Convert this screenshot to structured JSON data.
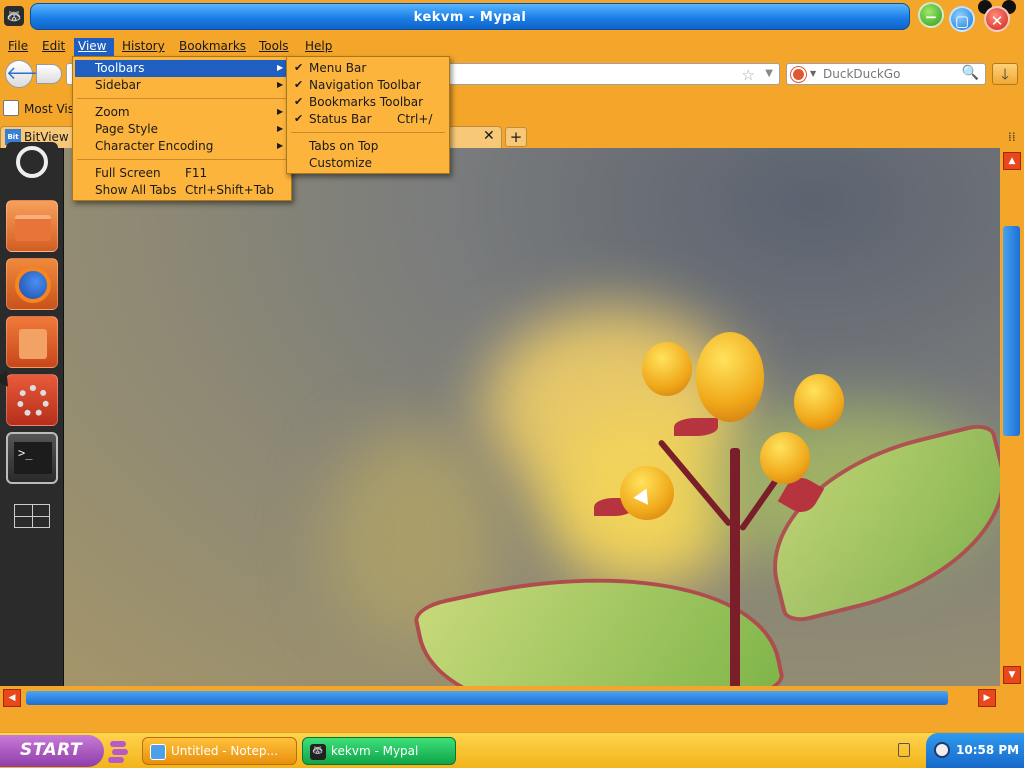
{
  "window": {
    "title": "kekvm - Mypal",
    "app_icon": "mypal-raccoon-icon"
  },
  "menubar": {
    "items": [
      {
        "label": "File",
        "mnemonic_index": 0
      },
      {
        "label": "Edit",
        "mnemonic_index": 0
      },
      {
        "label": "View",
        "mnemonic_index": 0,
        "active": true
      },
      {
        "label": "History",
        "mnemonic_index": 0
      },
      {
        "label": "Bookmarks",
        "mnemonic_index": 0
      },
      {
        "label": "Tools",
        "mnemonic_index": 0
      },
      {
        "label": "Help",
        "mnemonic_index": 0
      }
    ]
  },
  "view_menu": {
    "items": [
      {
        "label": "Toolbars",
        "submenu": true,
        "highlighted": true
      },
      {
        "label": "Sidebar",
        "submenu": true
      },
      {
        "label": "Zoom",
        "submenu": true
      },
      {
        "label": "Page Style",
        "submenu": true
      },
      {
        "label": "Character Encoding",
        "submenu": true
      },
      {
        "label": "Full Screen",
        "shortcut": "F11"
      },
      {
        "label": "Show All Tabs",
        "shortcut": "Ctrl+Shift+Tab"
      }
    ]
  },
  "toolbars_menu": {
    "items": [
      {
        "label": "Menu Bar",
        "checked": true
      },
      {
        "label": "Navigation Toolbar",
        "checked": true
      },
      {
        "label": "Bookmarks Toolbar",
        "checked": true
      },
      {
        "label": "Status Bar",
        "checked": true,
        "shortcut": "Ctrl+/"
      },
      {
        "label": "Tabs on Top",
        "checked": false
      },
      {
        "label": "Customize",
        "checked": false
      }
    ]
  },
  "navbar": {
    "url_value": "",
    "search": {
      "engine_icon": "duckduckgo-icon",
      "placeholder": "DuckDuckGo"
    }
  },
  "bookmarks": {
    "first_item": "Most Visi"
  },
  "tabs": [
    {
      "title": "BitView -",
      "favicon": "bitview-icon"
    }
  ],
  "launcher": {
    "items": [
      "ubuntu-icon",
      "files-icon",
      "firefox-icon",
      "software-center-icon",
      "system-settings-icon",
      "terminal-icon",
      "workspace-switcher-icon"
    ],
    "terminal_prompt": ">_"
  },
  "taskbar": {
    "start_label": "START",
    "tasks": [
      {
        "label": "Untitled - Notep...",
        "active": false
      },
      {
        "label": "kekvm - Mypal",
        "active": true
      }
    ],
    "clock": "10:58 PM"
  },
  "colors": {
    "chrome": "#f4a62a",
    "title_blue": "#1b7fe6",
    "highlight": "#1f5fc1",
    "taskbar_active": "#10a448"
  }
}
